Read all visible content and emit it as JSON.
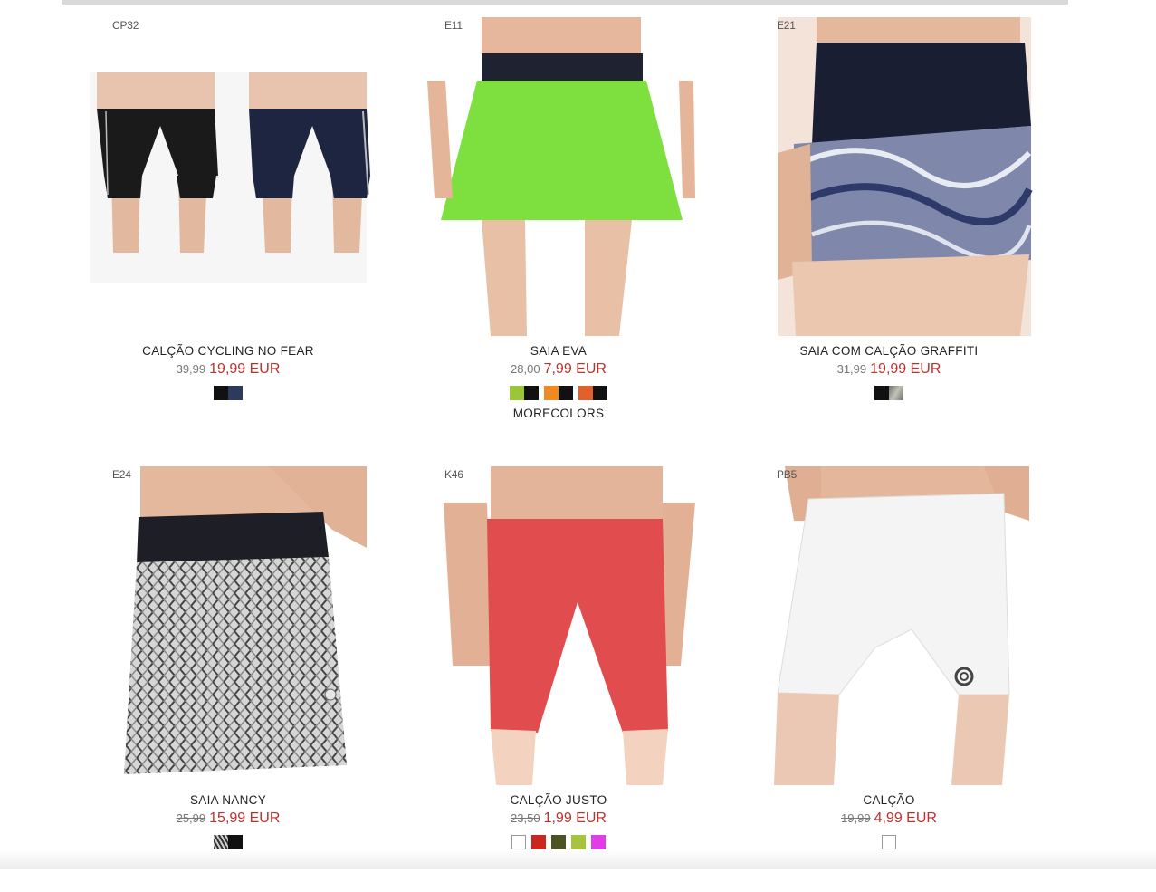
{
  "products": [
    {
      "code": "CP32",
      "name": "CALÇÃO CYCLING NO FEAR",
      "old_price": "39,99",
      "new_price": "19,99 EUR",
      "image": "cycling-shorts-photo",
      "swatches": [
        [
          "#111111",
          "#2c3a5c"
        ]
      ]
    },
    {
      "code": "E11",
      "name": "SAIA EVA",
      "old_price": "28,00",
      "new_price": "7,99 EUR",
      "image": "green-skirt-photo",
      "swatches": [
        [
          "#9bc63a",
          "#111111"
        ],
        [
          "#ef8a22",
          "#111111"
        ],
        [
          "#e0612c",
          "#111111"
        ]
      ],
      "more": "MORECOLORS"
    },
    {
      "code": "E21",
      "name": "SAIA COM CALÇÃO GRAFFITI",
      "old_price": "31,99",
      "new_price": "19,99 EUR",
      "image": "graffiti-skirt-photo",
      "swatches": [
        [
          "#111111",
          "#8f8f86"
        ]
      ]
    },
    {
      "code": "E24",
      "name": "SAIA NANCY",
      "old_price": "25,99",
      "new_price": "15,99 EUR",
      "image": "patterned-skirt-photo",
      "swatches": [
        [
          "#8a8a8a",
          "#111111"
        ]
      ]
    },
    {
      "code": "K46",
      "name": "CALÇÃO JUSTO",
      "old_price": "23,50",
      "new_price": "1,99 EUR",
      "image": "red-shorts-photo",
      "swatches": [
        [
          "#ffffff"
        ],
        [
          "#c8281e"
        ],
        [
          "#4d5225"
        ],
        [
          "#a8c43c"
        ],
        [
          "#e23ce6"
        ]
      ]
    },
    {
      "code": "PB5",
      "name": "CALÇÃO",
      "old_price": "19,99",
      "new_price": "4,99 EUR",
      "image": "white-shorts-photo",
      "swatches": [
        [
          "#ffffff"
        ]
      ]
    }
  ],
  "colors": {
    "sale_price": "#c0302b",
    "old_price": "#777777"
  }
}
